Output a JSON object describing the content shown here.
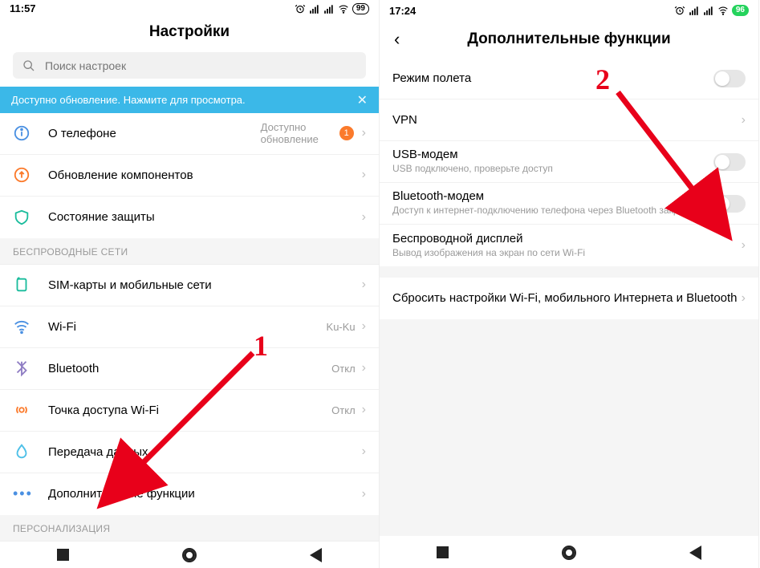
{
  "left": {
    "status": {
      "time": "11:57",
      "battery": "99"
    },
    "title": "Настройки",
    "search": {
      "placeholder": "Поиск настроек"
    },
    "banner": {
      "text": "Доступно обновление. Нажмите для просмотра.",
      "close": "✕"
    },
    "rows": {
      "about": {
        "label": "О телефоне",
        "value": "Доступно обновление",
        "badge": "1"
      },
      "components": {
        "label": "Обновление компонентов"
      },
      "security": {
        "label": "Состояние защиты"
      }
    },
    "section_wireless": "БЕСПРОВОДНЫЕ СЕТИ",
    "wireless": {
      "sim": {
        "label": "SIM-карты и мобильные сети"
      },
      "wifi": {
        "label": "Wi-Fi",
        "value": "Ku-Ku"
      },
      "bt": {
        "label": "Bluetooth",
        "value": "Откл"
      },
      "hotspot": {
        "label": "Точка доступа Wi-Fi",
        "value": "Откл"
      },
      "data": {
        "label": "Передача данных"
      },
      "more": {
        "label": "Дополнительные функции"
      }
    },
    "section_personal": "ПЕРСОНАЛИЗАЦИЯ"
  },
  "right": {
    "status": {
      "time": "17:24",
      "battery": "96"
    },
    "title": "Дополнительные функции",
    "rows": {
      "airplane": {
        "label": "Режим полета"
      },
      "vpn": {
        "label": "VPN"
      },
      "usb": {
        "label": "USB-модем",
        "sub": "USB подключено, проверьте доступ"
      },
      "btmodem": {
        "label": "Bluetooth-модем",
        "sub": "Доступ к интернет-подключению телефона через Bluetooth закрыт"
      },
      "wdisplay": {
        "label": "Беспроводной дисплей",
        "sub": "Вывод изображения на экран по сети Wi-Fi"
      },
      "reset": {
        "label": "Сбросить настройки Wi-Fi, мобильного Интернета и Bluetooth"
      }
    }
  },
  "annotations": {
    "one": "1",
    "two": "2"
  }
}
